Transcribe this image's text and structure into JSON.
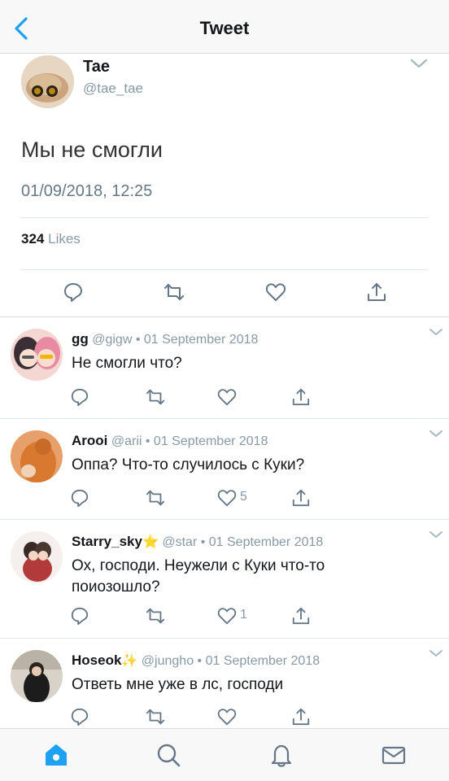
{
  "header": {
    "title": "Tweet",
    "back_icon": "chevron-left-icon",
    "accent": "#1da1f2"
  },
  "main_tweet": {
    "author_name": "Tae",
    "author_handle": "@tae_tae",
    "text": "Мы не смогли",
    "timestamp": "01/09/2018, 12:25",
    "like_count": "324",
    "likes_label": "Likes",
    "actions": [
      "reply-icon",
      "retweet-icon",
      "heart-icon",
      "share-icon"
    ]
  },
  "replies": [
    {
      "name": "gg",
      "handle_date": "@gigw • 01 September 2018",
      "text": "Не смогли что?",
      "like_count": ""
    },
    {
      "name": "Arooi",
      "handle_date": "@arii • 01 September 2018",
      "text": "Оппа? Что-то случилось с Куки?",
      "like_count": "5"
    },
    {
      "name": "Starry_sky",
      "name_emoji": "⭐",
      "handle_date": "@star • 01 September 2018",
      "text": "Ох, господи. Неужели с Куки что-то поиозошло?",
      "like_count": "1"
    },
    {
      "name": "Hoseok",
      "name_emoji": "✨",
      "handle_date": "@jungho • 01 September 2018",
      "text": "Ответь мне уже в лс, господи",
      "like_count": ""
    }
  ],
  "tabbar": {
    "items": [
      "home-icon",
      "search-icon",
      "notifications-icon",
      "messages-icon"
    ],
    "active": "home-icon"
  }
}
